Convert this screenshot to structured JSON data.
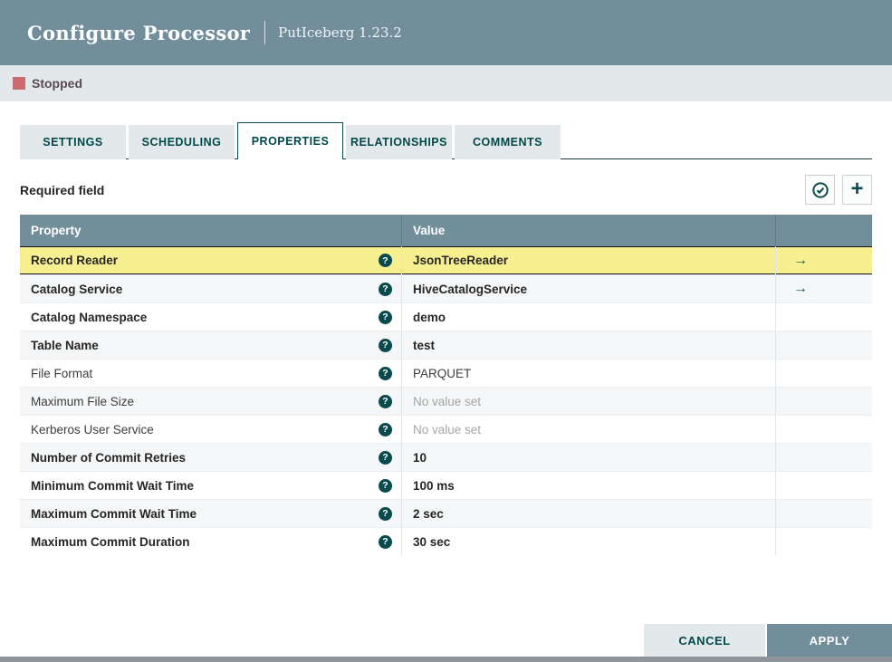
{
  "dialog": {
    "title": "Configure Processor",
    "subtitle": "PutIceberg 1.23.2"
  },
  "status": {
    "label": "Stopped",
    "color": "#c96b70"
  },
  "tabs": [
    {
      "label": "SETTINGS",
      "active": false
    },
    {
      "label": "SCHEDULING",
      "active": false
    },
    {
      "label": "PROPERTIES",
      "active": true
    },
    {
      "label": "RELATIONSHIPS",
      "active": false
    },
    {
      "label": "COMMENTS",
      "active": false
    }
  ],
  "properties_panel": {
    "required_hint": "Required field",
    "icons": [
      {
        "name": "verify-properties-icon",
        "glyph": "check-circle"
      },
      {
        "name": "add-property-icon",
        "glyph": "plus"
      }
    ]
  },
  "table": {
    "columns": [
      "Property",
      "Value"
    ],
    "rows": [
      {
        "property": "Record Reader",
        "required": true,
        "value": "JsonTreeReader",
        "value_state": "set",
        "link": true,
        "selected": true
      },
      {
        "property": "Catalog Service",
        "required": true,
        "value": "HiveCatalogService",
        "value_state": "set",
        "link": true,
        "selected": false
      },
      {
        "property": "Catalog Namespace",
        "required": true,
        "value": "demo",
        "value_state": "set",
        "link": false,
        "selected": false
      },
      {
        "property": "Table Name",
        "required": true,
        "value": "test",
        "value_state": "set",
        "link": false,
        "selected": false
      },
      {
        "property": "File Format",
        "required": false,
        "value": "PARQUET",
        "value_state": "default",
        "link": false,
        "selected": false
      },
      {
        "property": "Maximum File Size",
        "required": false,
        "value": "No value set",
        "value_state": "unset",
        "link": false,
        "selected": false
      },
      {
        "property": "Kerberos User Service",
        "required": false,
        "value": "No value set",
        "value_state": "unset",
        "link": false,
        "selected": false
      },
      {
        "property": "Number of Commit Retries",
        "required": true,
        "value": "10",
        "value_state": "set",
        "link": false,
        "selected": false
      },
      {
        "property": "Minimum Commit Wait Time",
        "required": true,
        "value": "100 ms",
        "value_state": "set",
        "link": false,
        "selected": false
      },
      {
        "property": "Maximum Commit Wait Time",
        "required": true,
        "value": "2 sec",
        "value_state": "set",
        "link": false,
        "selected": false
      },
      {
        "property": "Maximum Commit Duration",
        "required": true,
        "value": "30 sec",
        "value_state": "set",
        "link": false,
        "selected": false
      }
    ]
  },
  "footer": {
    "cancel_label": "CANCEL",
    "apply_label": "APPLY"
  },
  "colors": {
    "header_bg": "#728E9B",
    "statusbar_bg": "#E3E8EB",
    "accent_teal": "#004849",
    "selected_row_bg": "#F8EF90",
    "stopped_square": "#c96b70"
  }
}
